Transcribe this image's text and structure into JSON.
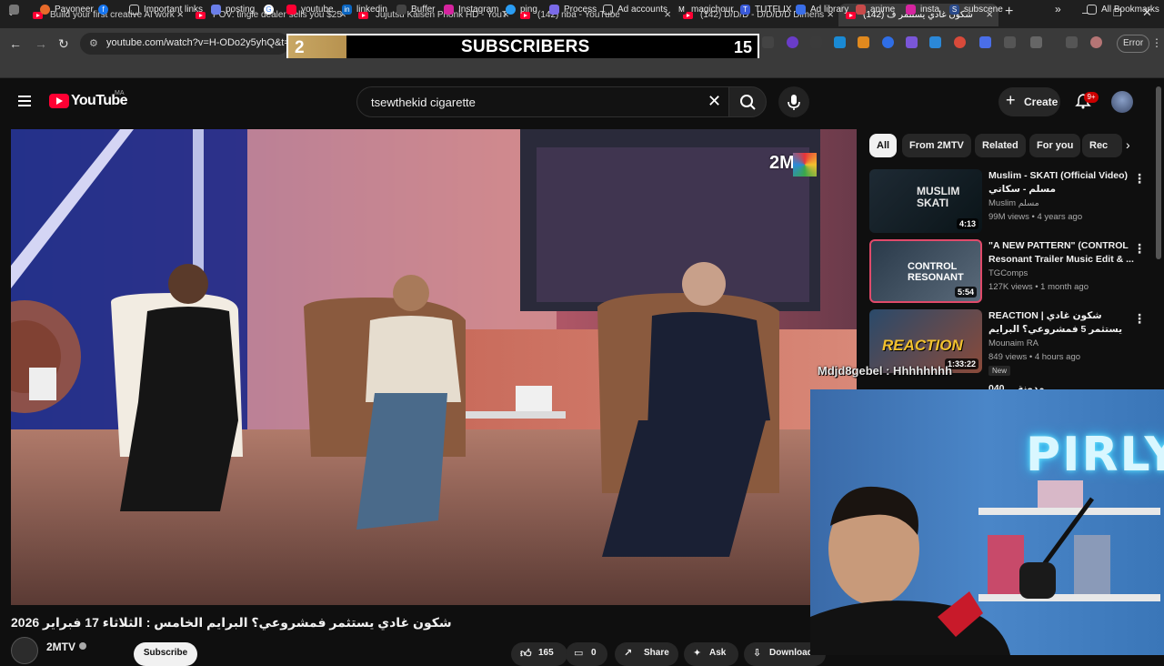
{
  "browser": {
    "tabs": [
      {
        "title": "Build your first creative AI work"
      },
      {
        "title": "POV: tingle dealer sells you $25"
      },
      {
        "title": "Jujutsu Kaisen Phonk HD - YouT"
      },
      {
        "title": "(142) nba - YouTube"
      },
      {
        "title": "(142) D/D/D - D/D/D/D Dimens"
      },
      {
        "title": "(142) شكون غادي يستثمر ف"
      }
    ],
    "url": "youtube.com/watch?v=H-ODo2y5yhQ&t=",
    "error_label": "Error",
    "bookmarks": [
      {
        "label": "Payoneer"
      },
      {
        "label": "Important links"
      },
      {
        "label": "posting"
      },
      {
        "label": "youtube"
      },
      {
        "label": "linkedin"
      },
      {
        "label": "Buffer"
      },
      {
        "label": "Instagram"
      },
      {
        "label": "ping"
      },
      {
        "label": "Process"
      },
      {
        "label": "Ad accounts"
      },
      {
        "label": "magichour"
      },
      {
        "label": "TUTFLIX"
      },
      {
        "label": "Ad library"
      },
      {
        "label": "anime"
      },
      {
        "label": "insta"
      },
      {
        "label": "subscene"
      }
    ],
    "all_bookmarks": "All Bookmarks"
  },
  "overlay": {
    "digit": "2",
    "label": "SUBSCRIBERS",
    "count": "15"
  },
  "youtube": {
    "logo_text": "YouTube",
    "country_code": "MA",
    "search_query": "tsewthekid cigarette",
    "create_label": "Create",
    "notification_count": "9+"
  },
  "video": {
    "channel_watermark": "2M",
    "title": "شكون غادي يستثمر فمشروعي؟ البرايم الخامس : الثلاثاء 17 فبراير 2026",
    "channel": "2MTV",
    "subscribe_label": "Subscribe",
    "likes": "165",
    "comments": "0",
    "share_label": "Share",
    "ask_label": "Ask",
    "download_label": "Download"
  },
  "chips": [
    "All",
    "From 2MTV",
    "Related",
    "For you",
    "Rec"
  ],
  "recommendations": [
    {
      "title": "Muslim - SKATI (Official Video) مسلم - سكاتي",
      "channel": "Muslim مسلم",
      "meta": "99M views • 4 years ago",
      "duration": "4:13",
      "thumb_text": "MUSLIM SKATI"
    },
    {
      "title": "\"A NEW PATTERN\" (CONTROL Resonant Trailer Music Edit & ...",
      "channel": "TGComps",
      "meta": "127K views • 1 month ago",
      "duration": "5:54",
      "thumb_text": "CONTROL RESONANT"
    },
    {
      "title": "REACTION | شكون غادي يستثمر 5 فمشروعي؟ البرايم",
      "channel": "Mounaim RA",
      "meta": "849 views • 4 hours ago",
      "duration": "1:33:22",
      "badge": "New",
      "thumb_text": "REACTION"
    },
    {
      "title": "040 ... مدونة",
      "channel": "",
      "meta": "",
      "duration": "",
      "thumb_text": ""
    }
  ],
  "stream": {
    "chat_message": "Mdjd8gebel : Hhhhhhhh",
    "neon_sign": "PIRLY"
  },
  "colors": {
    "accent_red": "#ff0033",
    "background": "#0f0f0f",
    "overlay_gold": "#c8a764",
    "neon": "#6ee8ff"
  }
}
